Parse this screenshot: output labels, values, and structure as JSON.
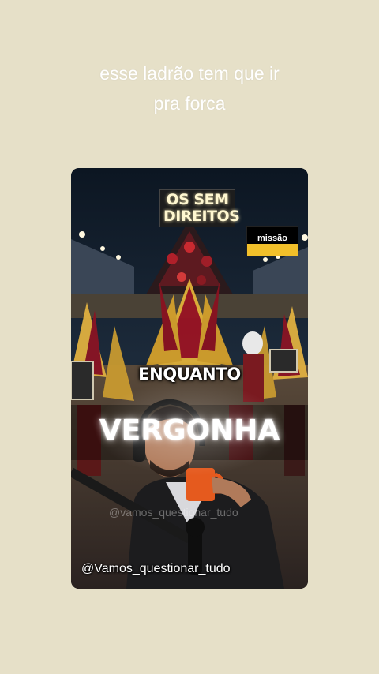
{
  "caption": {
    "line1": "esse ladrão tem que ir",
    "line2": "pra forca"
  },
  "video": {
    "top_tag_line1": "OS SEM",
    "top_tag_line2": "DIREITOS",
    "logo_text": "missão",
    "overlay_word": "ENQUANTO",
    "headline": "VERGONHA",
    "watermark_faint": "@vamos_questionar_tudo",
    "watermark": "@Vamos_questionar_tudo"
  },
  "colors": {
    "background": "#e6e0c8",
    "caption_text": "#ffffff",
    "logo_yellow": "#f2c02a",
    "logo_black": "#000000"
  }
}
